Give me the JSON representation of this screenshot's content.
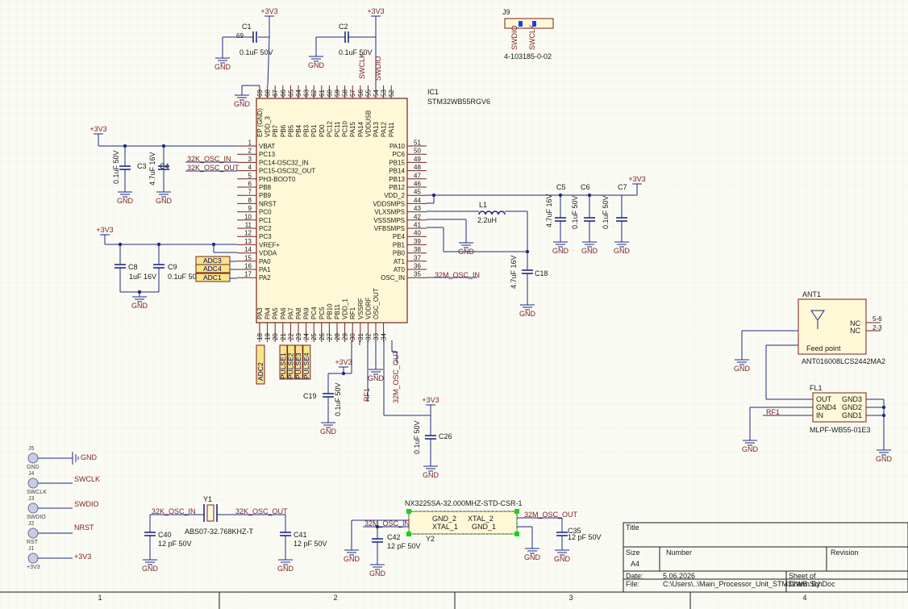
{
  "ic1": {
    "designator": "IC1",
    "part": "STM32WB55RGV6",
    "left_pins": [
      {
        "num": "1",
        "name": "VBAT"
      },
      {
        "num": "2",
        "name": "PC13"
      },
      {
        "num": "3",
        "name": "PC14-OSC32_IN"
      },
      {
        "num": "4",
        "name": "PC15-OSC32_OUT"
      },
      {
        "num": "5",
        "name": "PH3-BOOT0"
      },
      {
        "num": "6",
        "name": "PB8"
      },
      {
        "num": "7",
        "name": "PB9"
      },
      {
        "num": "8",
        "name": "NRST"
      },
      {
        "num": "9",
        "name": "PC0"
      },
      {
        "num": "10",
        "name": "PC1"
      },
      {
        "num": "11",
        "name": "PC2"
      },
      {
        "num": "12",
        "name": "PC3"
      },
      {
        "num": "13",
        "name": "VREF+"
      },
      {
        "num": "14",
        "name": "VDDA"
      },
      {
        "num": "15",
        "name": "PA0"
      },
      {
        "num": "16",
        "name": "PA1"
      },
      {
        "num": "17",
        "name": "PA2"
      }
    ],
    "right_pins": [
      {
        "num": "51",
        "name": "PA10"
      },
      {
        "num": "50",
        "name": "PC6"
      },
      {
        "num": "49",
        "name": "PB15"
      },
      {
        "num": "48",
        "name": "PB14"
      },
      {
        "num": "47",
        "name": "PB13"
      },
      {
        "num": "46",
        "name": "PB12"
      },
      {
        "num": "45",
        "name": "VDD_2"
      },
      {
        "num": "44",
        "name": "VDDSMPS"
      },
      {
        "num": "43",
        "name": "VLXSMPS"
      },
      {
        "num": "42",
        "name": "VSSSMPS"
      },
      {
        "num": "41",
        "name": "VFBSMPS"
      },
      {
        "num": "40",
        "name": "PE4"
      },
      {
        "num": "39",
        "name": "PB1"
      },
      {
        "num": "38",
        "name": "PB0"
      },
      {
        "num": "37",
        "name": "AT1"
      },
      {
        "num": "36",
        "name": "AT0"
      },
      {
        "num": "35",
        "name": "OSC_IN"
      }
    ],
    "top_pins": [
      {
        "num": "69",
        "name": "EP (GND)"
      },
      {
        "num": "68",
        "name": "VDD_3"
      },
      {
        "num": "67",
        "name": "PB7"
      },
      {
        "num": "66",
        "name": "PB6"
      },
      {
        "num": "65",
        "name": "PB5"
      },
      {
        "num": "64",
        "name": "PB4"
      },
      {
        "num": "63",
        "name": "PB3"
      },
      {
        "num": "62",
        "name": "PD1"
      },
      {
        "num": "61",
        "name": "PD0"
      },
      {
        "num": "60",
        "name": "PC12"
      },
      {
        "num": "59",
        "name": "PC11"
      },
      {
        "num": "58",
        "name": "PC10"
      },
      {
        "num": "57",
        "name": "PA15"
      },
      {
        "num": "56",
        "name": "PA14"
      },
      {
        "num": "55",
        "name": "VDDUSB"
      },
      {
        "num": "54",
        "name": "PA13"
      },
      {
        "num": "53",
        "name": "PA12"
      },
      {
        "num": "52",
        "name": "PA11"
      }
    ],
    "bottom_pins": [
      {
        "num": "18",
        "name": "PA3"
      },
      {
        "num": "19",
        "name": "PA4"
      },
      {
        "num": "20",
        "name": "PA5"
      },
      {
        "num": "21",
        "name": "PA6"
      },
      {
        "num": "22",
        "name": "PA7"
      },
      {
        "num": "23",
        "name": "PA8"
      },
      {
        "num": "24",
        "name": "PA9"
      },
      {
        "num": "25",
        "name": "PC4"
      },
      {
        "num": "26",
        "name": "PC5"
      },
      {
        "num": "27",
        "name": "PB10"
      },
      {
        "num": "28",
        "name": "PB11"
      },
      {
        "num": "29",
        "name": "VDD_1"
      },
      {
        "num": "30",
        "name": "RF1"
      },
      {
        "num": "31",
        "name": "VSSRF"
      },
      {
        "num": "32",
        "name": "VDDRF"
      },
      {
        "num": "33",
        "name": "OSC_OUT"
      },
      {
        "num": "34",
        "name": ""
      }
    ]
  },
  "nets": {
    "v33": "+3V3",
    "gnd": "GND",
    "osc32_in": "32K_OSC_IN",
    "osc32_out": "32K_OSC_OUT",
    "osc32m_in": "32M_OSC_IN",
    "osc32m_out": "32M_OSC_OUT",
    "rf1": "RF1",
    "swclk": "SWCLK",
    "swdio": "SWDIO",
    "nrst": "NRST",
    "adc1": "ADC1",
    "adc2": "ADC2",
    "adc3": "ADC3",
    "adc4": "ADC4",
    "pulse1": "PULSE1",
    "pulse2": "PULSE2",
    "pulse3": "PULSE3",
    "pulse4": "PULSE4"
  },
  "caps": {
    "c1": {
      "des": "C1",
      "val": "0.1uF 50V"
    },
    "c2": {
      "des": "C2",
      "val": "0.1uF 50V"
    },
    "c3": {
      "des": "C3",
      "val": "0.1uF 50V"
    },
    "c4": {
      "des": "C4",
      "val": "4.7uF 16V"
    },
    "c5": {
      "des": "C5",
      "val": "4.7uF 16V"
    },
    "c6": {
      "des": "C6",
      "val": "0.1uF 50V"
    },
    "c7": {
      "des": "C7",
      "val": "0.1uF 50V"
    },
    "c8": {
      "des": "C8",
      "val": "1uF 16V"
    },
    "c9": {
      "des": "C9",
      "val": "0.1uF 50V"
    },
    "c18": {
      "des": "C18",
      "val": "4.7uF 16V"
    },
    "c19": {
      "des": "C19",
      "val": "0.1uF 50V"
    },
    "c26": {
      "des": "C26",
      "val": "0.1uF 50V"
    },
    "c40": {
      "des": "C40",
      "val": "12 pF 50V"
    },
    "c41": {
      "des": "C41",
      "val": "12 pF 50V"
    },
    "c42": {
      "des": "C42",
      "val": "12 pF 50V"
    },
    "c35": {
      "des": "C35",
      "val": "12 pF 50V"
    }
  },
  "l1": {
    "des": "L1",
    "val": "2.2uH"
  },
  "j9": {
    "des": "J9",
    "part": "4-103185-0-02",
    "pin1": "SWDIO",
    "pin2": "SWCLK"
  },
  "ant1": {
    "des": "ANT1",
    "part": "ANT016008LCS2442MA2",
    "feed": "Feed point",
    "nc1": "NC",
    "nc2": "NC",
    "p1": "5-6",
    "p2": "2-3"
  },
  "fl1": {
    "des": "FL1",
    "part": "MLPF-WB55-01E3",
    "out": "OUT",
    "gnd4": "GND4",
    "in": "IN",
    "gnd3": "GND3",
    "gnd2": "GND2",
    "gnd1": "GND1"
  },
  "y1": {
    "des": "Y1",
    "part": "ABS07-32.768KHZ-T"
  },
  "y2": {
    "des": "Y2",
    "part": "NX3225SA-32.000MHZ-STD-CSR-1",
    "gnd2": "GND_2",
    "xtal2": "XTAL_2",
    "xtal1": "XTAL_1",
    "gnd1": "GND_1"
  },
  "testpoints": [
    {
      "des": "J5",
      "label": "GND"
    },
    {
      "des": "J4",
      "label": "SWCLK"
    },
    {
      "des": "J3",
      "label": "SWDIO"
    },
    {
      "des": "J2",
      "label": "RST"
    },
    {
      "des": "J1",
      "label": "+3V3"
    }
  ],
  "titleblock": {
    "title": "Title",
    "size": "Size",
    "size_val": "A4",
    "number": "Number",
    "revision": "Revision",
    "date": "Date:",
    "date_val": "5.06.2026",
    "sheet": "Sheet   of",
    "file": "File:",
    "file_val": "C:\\Users\\..\\Main_Processor_Unit_STM32WB.SchDoc",
    "drawn": "Drawn By:"
  },
  "zones": [
    "1",
    "2",
    "3",
    "4"
  ]
}
